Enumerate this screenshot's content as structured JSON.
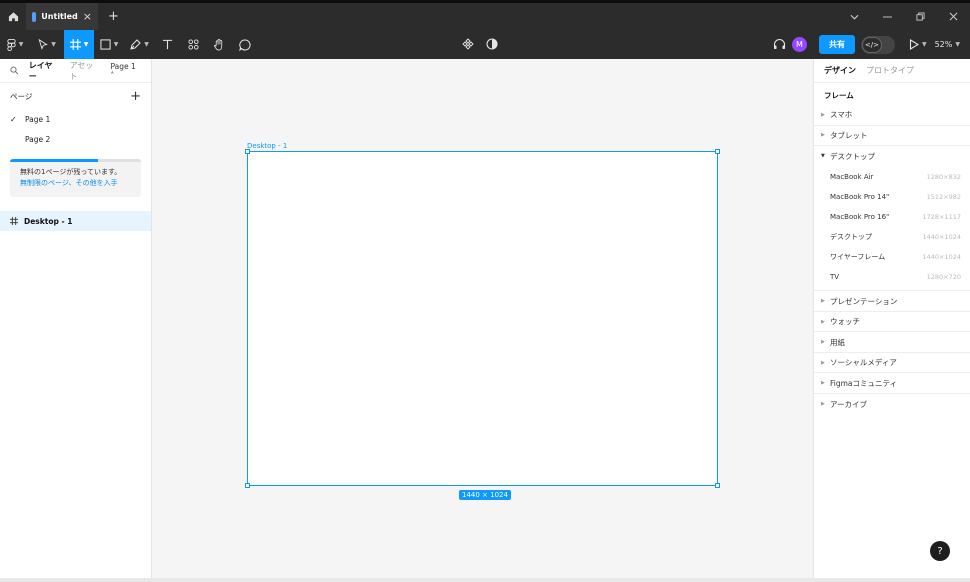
{
  "titlebar": {
    "tab_title": "Untitled",
    "tab_close": "×",
    "new_tab": "+"
  },
  "toolbar": {
    "share_label": "共有",
    "avatar_initial": "M",
    "zoom_level": "52%"
  },
  "left_panel": {
    "tabs": {
      "layers": "レイヤー",
      "assets": "アセット"
    },
    "page_selector": "Page 1 ˄",
    "pages_heading": "ページ",
    "add_page": "+",
    "pages": [
      {
        "label": "Page 1",
        "checked": true
      },
      {
        "label": "Page 2",
        "checked": false
      }
    ],
    "promo": {
      "message": "無料の1ページが残っています。",
      "link": "無制限のページ、その他を入手",
      "progress": 0.67
    },
    "layers": [
      {
        "label": "Desktop - 1"
      }
    ]
  },
  "canvas": {
    "frame_label": "Desktop - 1",
    "frame_size": "1440 × 1024"
  },
  "right_panel": {
    "tabs": {
      "design": "デザイン",
      "prototype": "プロトタイプ"
    },
    "section_title": "フレーム",
    "categories_top": [
      {
        "label": "スマホ"
      },
      {
        "label": "タブレット"
      }
    ],
    "open_category": "デスクトップ",
    "presets": [
      {
        "name": "MacBook Air",
        "size": "1280×832"
      },
      {
        "name": "MacBook Pro 14\"",
        "size": "1512×982"
      },
      {
        "name": "MacBook Pro 16\"",
        "size": "1728×1117"
      },
      {
        "name": "デスクトップ",
        "size": "1440×1024"
      },
      {
        "name": "ワイヤーフレーム",
        "size": "1440×1024"
      },
      {
        "name": "TV",
        "size": "1280×720"
      }
    ],
    "categories_bottom": [
      {
        "label": "プレゼンテーション"
      },
      {
        "label": "ウォッチ"
      },
      {
        "label": "用紙"
      },
      {
        "label": "ソーシャルメディア"
      },
      {
        "label": "Figmaコミュニティ"
      },
      {
        "label": "アーカイブ"
      }
    ],
    "help": "?"
  }
}
